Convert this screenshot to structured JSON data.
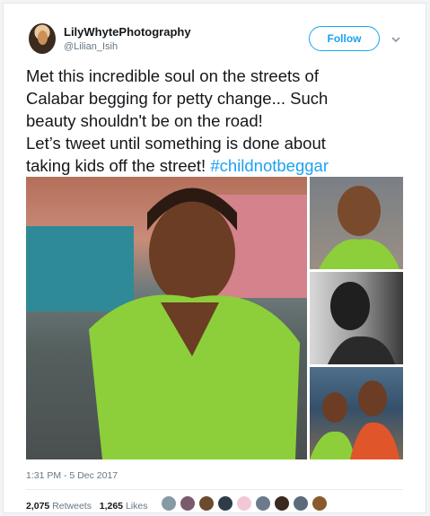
{
  "user": {
    "display_name": "LilyWhytePhotography",
    "handle": "@Lilian_Isih"
  },
  "follow_button": {
    "label": "Follow"
  },
  "tweet": {
    "lines": [
      "Met this incredible soul on the streets of",
      "Calabar begging for petty change... Such",
      "beauty shouldn't be on the road!",
      "Let’s tweet until something is done about",
      "taking kids off the street! "
    ],
    "hashtag": "#childnotbeggar"
  },
  "timestamp": "1:31 PM - 5 Dec 2017",
  "stats": {
    "retweets_count": "2,075",
    "retweets_label": "Retweets",
    "likes_count": "1,265",
    "likes_label": "Likes"
  },
  "icons": {
    "menu": "chevron-down-icon"
  },
  "colors": {
    "accent": "#1da1f2",
    "text": "#14171a",
    "muted": "#657786"
  },
  "likers": [
    {
      "color": "#8899a6"
    },
    {
      "color": "#7b5a6e"
    },
    {
      "color": "#6b4a2f"
    },
    {
      "color": "#2f3a4a"
    },
    {
      "color": "#f4c7d6"
    },
    {
      "color": "#6c7a8a"
    },
    {
      "color": "#3a2a1f"
    },
    {
      "color": "#5b6b7a"
    },
    {
      "color": "#8a5a2a"
    }
  ]
}
